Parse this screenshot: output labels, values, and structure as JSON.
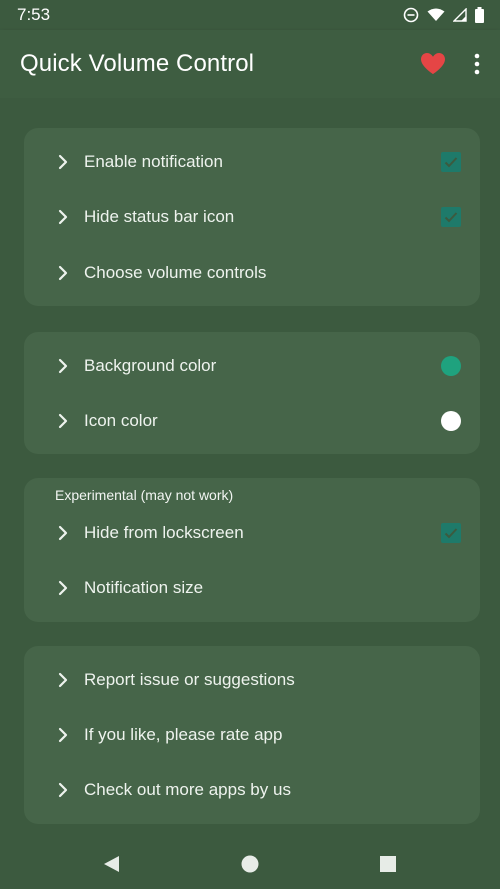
{
  "status_bar": {
    "time": "7:53",
    "icons": [
      "do-not-disturb-icon",
      "wifi-icon",
      "signal-icon",
      "battery-icon"
    ]
  },
  "app_bar": {
    "title": "Quick Volume Control",
    "heart_icon": "heart-icon",
    "menu_icon": "overflow-menu-icon"
  },
  "colors": {
    "background": "#3c5a3f",
    "card": "#466549",
    "checkbox": "#1e7a6a",
    "heart": "#e54545",
    "background_color_swatch": "#1fa27e",
    "icon_color_swatch": "#ffffff"
  },
  "card1": {
    "items": [
      {
        "label": "Enable notification",
        "control": "checkbox",
        "checked": true
      },
      {
        "label": "Hide status bar icon",
        "control": "checkbox",
        "checked": true
      },
      {
        "label": "Choose volume controls",
        "control": "none"
      }
    ]
  },
  "card2": {
    "items": [
      {
        "label": "Background color",
        "control": "color-swatch"
      },
      {
        "label": "Icon color",
        "control": "color-swatch"
      }
    ]
  },
  "card3": {
    "header": "Experimental (may not work)",
    "items": [
      {
        "label": "Hide from lockscreen",
        "control": "checkbox",
        "checked": true
      },
      {
        "label": "Notification size",
        "control": "none"
      }
    ]
  },
  "card4": {
    "items": [
      {
        "label": "Report issue or suggestions"
      },
      {
        "label": "If you like, please rate app"
      },
      {
        "label": "Check out more apps by us"
      }
    ]
  },
  "nav_bar": {
    "buttons": [
      "back-icon",
      "home-icon",
      "recents-icon"
    ]
  }
}
